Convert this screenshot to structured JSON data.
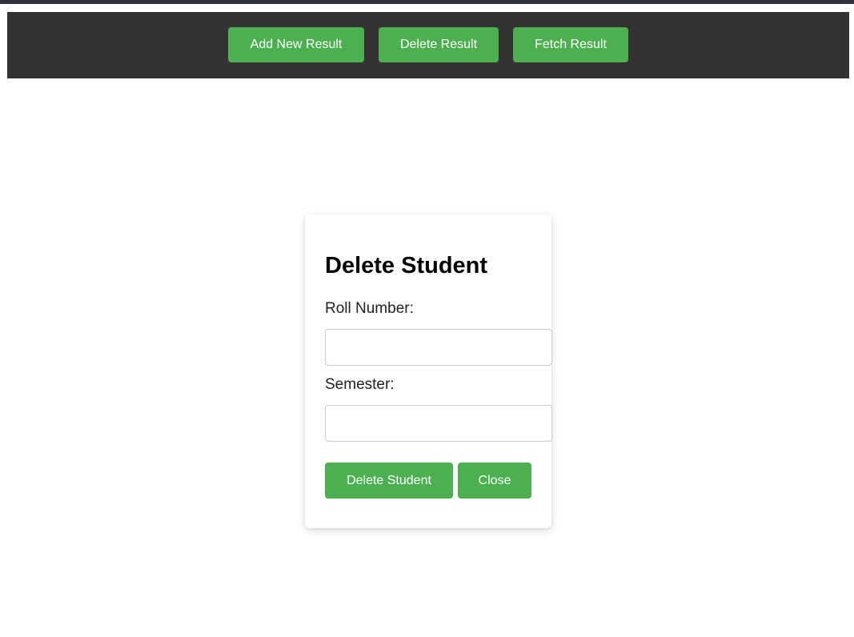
{
  "nav": {
    "add_label": "Add New Result",
    "delete_label": "Delete Result",
    "fetch_label": "Fetch Result"
  },
  "modal": {
    "title": "Delete Student",
    "roll_label": "Roll Number:",
    "roll_value": "",
    "semester_label": "Semester:",
    "semester_value": "",
    "delete_button": "Delete Student",
    "close_button": "Close"
  },
  "colors": {
    "accent": "#4caf50",
    "navbar": "#333333",
    "top_stripe": "#30323d"
  }
}
